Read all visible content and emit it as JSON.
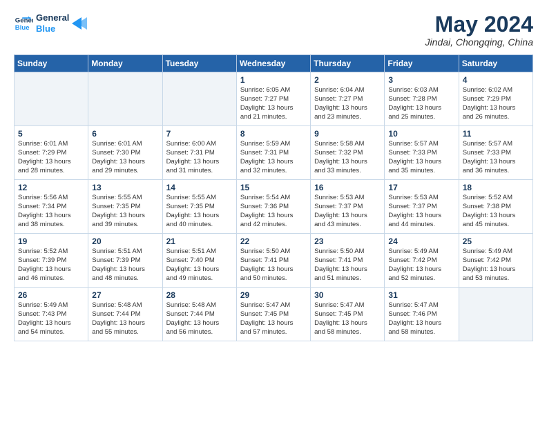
{
  "logo": {
    "line1": "General",
    "line2": "Blue"
  },
  "title": "May 2024",
  "location": "Jindai, Chongqing, China",
  "days_of_week": [
    "Sunday",
    "Monday",
    "Tuesday",
    "Wednesday",
    "Thursday",
    "Friday",
    "Saturday"
  ],
  "weeks": [
    [
      {
        "day": "",
        "content": ""
      },
      {
        "day": "",
        "content": ""
      },
      {
        "day": "",
        "content": ""
      },
      {
        "day": "1",
        "content": "Sunrise: 6:05 AM\nSunset: 7:27 PM\nDaylight: 13 hours\nand 21 minutes."
      },
      {
        "day": "2",
        "content": "Sunrise: 6:04 AM\nSunset: 7:27 PM\nDaylight: 13 hours\nand 23 minutes."
      },
      {
        "day": "3",
        "content": "Sunrise: 6:03 AM\nSunset: 7:28 PM\nDaylight: 13 hours\nand 25 minutes."
      },
      {
        "day": "4",
        "content": "Sunrise: 6:02 AM\nSunset: 7:29 PM\nDaylight: 13 hours\nand 26 minutes."
      }
    ],
    [
      {
        "day": "5",
        "content": "Sunrise: 6:01 AM\nSunset: 7:29 PM\nDaylight: 13 hours\nand 28 minutes."
      },
      {
        "day": "6",
        "content": "Sunrise: 6:01 AM\nSunset: 7:30 PM\nDaylight: 13 hours\nand 29 minutes."
      },
      {
        "day": "7",
        "content": "Sunrise: 6:00 AM\nSunset: 7:31 PM\nDaylight: 13 hours\nand 31 minutes."
      },
      {
        "day": "8",
        "content": "Sunrise: 5:59 AM\nSunset: 7:31 PM\nDaylight: 13 hours\nand 32 minutes."
      },
      {
        "day": "9",
        "content": "Sunrise: 5:58 AM\nSunset: 7:32 PM\nDaylight: 13 hours\nand 33 minutes."
      },
      {
        "day": "10",
        "content": "Sunrise: 5:57 AM\nSunset: 7:33 PM\nDaylight: 13 hours\nand 35 minutes."
      },
      {
        "day": "11",
        "content": "Sunrise: 5:57 AM\nSunset: 7:33 PM\nDaylight: 13 hours\nand 36 minutes."
      }
    ],
    [
      {
        "day": "12",
        "content": "Sunrise: 5:56 AM\nSunset: 7:34 PM\nDaylight: 13 hours\nand 38 minutes."
      },
      {
        "day": "13",
        "content": "Sunrise: 5:55 AM\nSunset: 7:35 PM\nDaylight: 13 hours\nand 39 minutes."
      },
      {
        "day": "14",
        "content": "Sunrise: 5:55 AM\nSunset: 7:35 PM\nDaylight: 13 hours\nand 40 minutes."
      },
      {
        "day": "15",
        "content": "Sunrise: 5:54 AM\nSunset: 7:36 PM\nDaylight: 13 hours\nand 42 minutes."
      },
      {
        "day": "16",
        "content": "Sunrise: 5:53 AM\nSunset: 7:37 PM\nDaylight: 13 hours\nand 43 minutes."
      },
      {
        "day": "17",
        "content": "Sunrise: 5:53 AM\nSunset: 7:37 PM\nDaylight: 13 hours\nand 44 minutes."
      },
      {
        "day": "18",
        "content": "Sunrise: 5:52 AM\nSunset: 7:38 PM\nDaylight: 13 hours\nand 45 minutes."
      }
    ],
    [
      {
        "day": "19",
        "content": "Sunrise: 5:52 AM\nSunset: 7:39 PM\nDaylight: 13 hours\nand 46 minutes."
      },
      {
        "day": "20",
        "content": "Sunrise: 5:51 AM\nSunset: 7:39 PM\nDaylight: 13 hours\nand 48 minutes."
      },
      {
        "day": "21",
        "content": "Sunrise: 5:51 AM\nSunset: 7:40 PM\nDaylight: 13 hours\nand 49 minutes."
      },
      {
        "day": "22",
        "content": "Sunrise: 5:50 AM\nSunset: 7:41 PM\nDaylight: 13 hours\nand 50 minutes."
      },
      {
        "day": "23",
        "content": "Sunrise: 5:50 AM\nSunset: 7:41 PM\nDaylight: 13 hours\nand 51 minutes."
      },
      {
        "day": "24",
        "content": "Sunrise: 5:49 AM\nSunset: 7:42 PM\nDaylight: 13 hours\nand 52 minutes."
      },
      {
        "day": "25",
        "content": "Sunrise: 5:49 AM\nSunset: 7:42 PM\nDaylight: 13 hours\nand 53 minutes."
      }
    ],
    [
      {
        "day": "26",
        "content": "Sunrise: 5:49 AM\nSunset: 7:43 PM\nDaylight: 13 hours\nand 54 minutes."
      },
      {
        "day": "27",
        "content": "Sunrise: 5:48 AM\nSunset: 7:44 PM\nDaylight: 13 hours\nand 55 minutes."
      },
      {
        "day": "28",
        "content": "Sunrise: 5:48 AM\nSunset: 7:44 PM\nDaylight: 13 hours\nand 56 minutes."
      },
      {
        "day": "29",
        "content": "Sunrise: 5:47 AM\nSunset: 7:45 PM\nDaylight: 13 hours\nand 57 minutes."
      },
      {
        "day": "30",
        "content": "Sunrise: 5:47 AM\nSunset: 7:45 PM\nDaylight: 13 hours\nand 58 minutes."
      },
      {
        "day": "31",
        "content": "Sunrise: 5:47 AM\nSunset: 7:46 PM\nDaylight: 13 hours\nand 58 minutes."
      },
      {
        "day": "",
        "content": ""
      }
    ]
  ]
}
